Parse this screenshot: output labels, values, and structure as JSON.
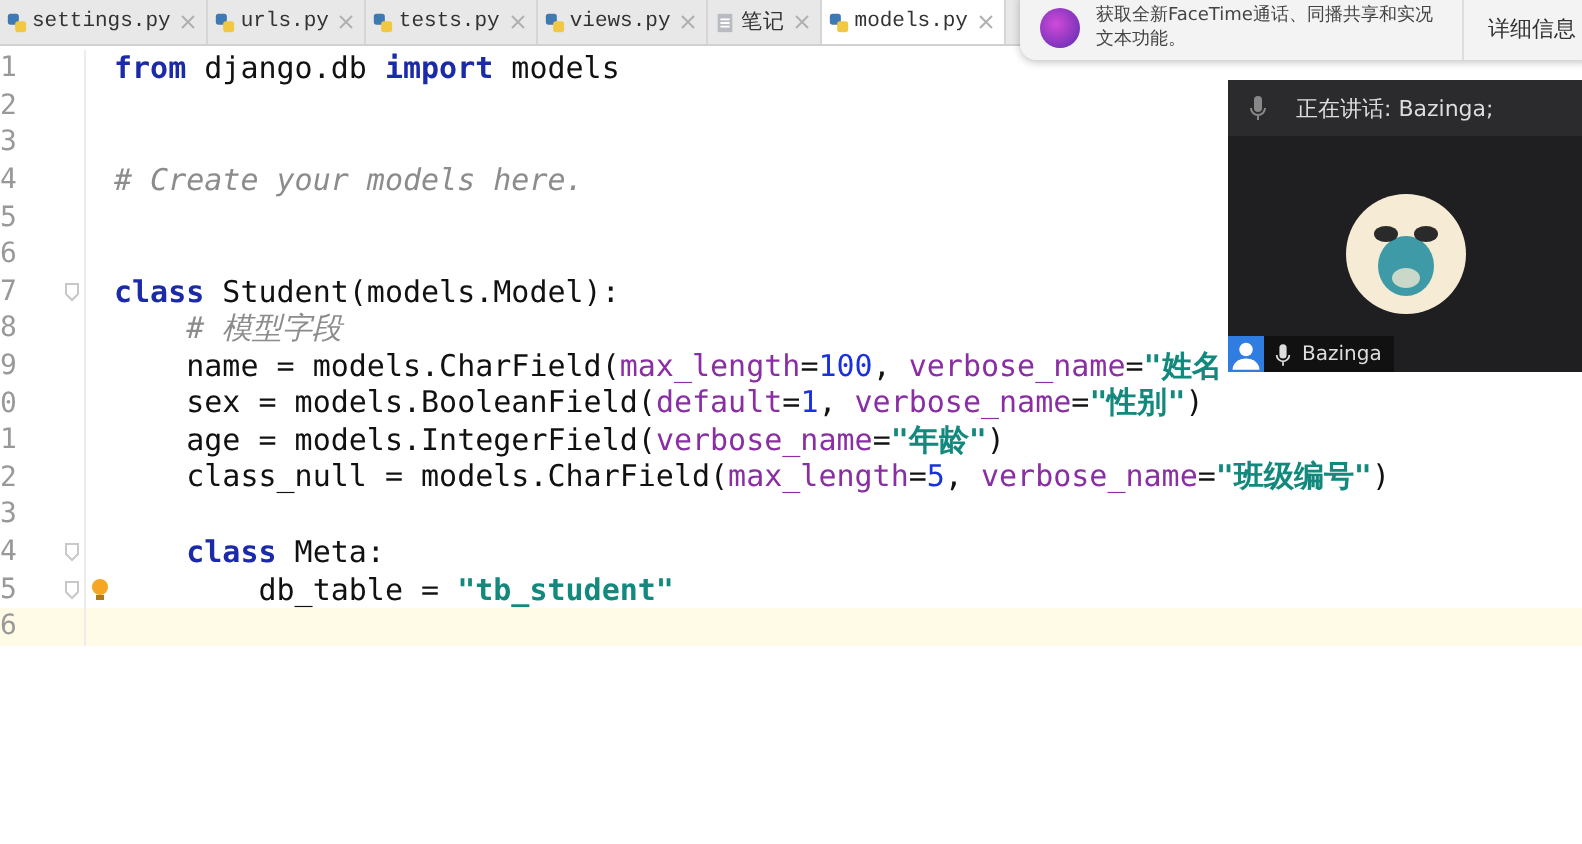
{
  "tabs": [
    {
      "label": "settings.py",
      "kind": "python",
      "selected": false
    },
    {
      "label": "urls.py",
      "kind": "python",
      "selected": false
    },
    {
      "label": "tests.py",
      "kind": "python",
      "selected": false
    },
    {
      "label": "views.py",
      "kind": "python",
      "selected": false
    },
    {
      "label": "笔记",
      "kind": "text",
      "selected": false
    },
    {
      "label": "models.py",
      "kind": "python",
      "selected": true
    }
  ],
  "editor": {
    "lines": [
      {
        "number": "1",
        "tokens": [
          {
            "kind": "keyword",
            "text": "from"
          },
          {
            "kind": "plain",
            "text": " django.db "
          },
          {
            "kind": "keyword",
            "text": "import"
          },
          {
            "kind": "plain",
            "text": " models"
          }
        ]
      },
      {
        "number": "2"
      },
      {
        "number": "3"
      },
      {
        "number": "4",
        "tokens": [
          {
            "kind": "comment",
            "text": "# Create your models here."
          }
        ]
      },
      {
        "number": "5"
      },
      {
        "number": "6"
      },
      {
        "number": "7",
        "fold": true,
        "tokens": [
          {
            "kind": "keyword",
            "text": "class"
          },
          {
            "kind": "plain",
            "text": " Student(models.Model):"
          }
        ]
      },
      {
        "number": "8",
        "tokens": [
          {
            "kind": "comment",
            "text": "    # 模型字段"
          }
        ]
      },
      {
        "number": "9",
        "tokens": [
          {
            "kind": "plain",
            "text": "    name = models.CharField("
          },
          {
            "kind": "param",
            "text": "max_length"
          },
          {
            "kind": "plain",
            "text": "="
          },
          {
            "kind": "number",
            "text": "100"
          },
          {
            "kind": "plain",
            "text": ", "
          },
          {
            "kind": "param",
            "text": "verbose_name"
          },
          {
            "kind": "plain",
            "text": "="
          },
          {
            "kind": "string",
            "text": "\"姓名"
          }
        ]
      },
      {
        "number": "0",
        "tokens": [
          {
            "kind": "plain",
            "text": "    sex = models.BooleanField("
          },
          {
            "kind": "param",
            "text": "default"
          },
          {
            "kind": "plain",
            "text": "="
          },
          {
            "kind": "number",
            "text": "1"
          },
          {
            "kind": "plain",
            "text": ", "
          },
          {
            "kind": "param",
            "text": "verbose_name"
          },
          {
            "kind": "plain",
            "text": "="
          },
          {
            "kind": "string",
            "text": "\"性别\""
          },
          {
            "kind": "plain",
            "text": ")"
          }
        ]
      },
      {
        "number": "1",
        "tokens": [
          {
            "kind": "plain",
            "text": "    age = models.IntegerField("
          },
          {
            "kind": "param",
            "text": "verbose_name"
          },
          {
            "kind": "plain",
            "text": "="
          },
          {
            "kind": "string",
            "text": "\"年龄\""
          },
          {
            "kind": "plain",
            "text": ")"
          }
        ]
      },
      {
        "number": "2",
        "tokens": [
          {
            "kind": "plain",
            "text": "    class_null = models.CharField("
          },
          {
            "kind": "param",
            "text": "max_length"
          },
          {
            "kind": "plain",
            "text": "="
          },
          {
            "kind": "number",
            "text": "5"
          },
          {
            "kind": "plain",
            "text": ", "
          },
          {
            "kind": "param",
            "text": "verbose_name"
          },
          {
            "kind": "plain",
            "text": "="
          },
          {
            "kind": "string",
            "text": "\"班级编号\""
          },
          {
            "kind": "plain",
            "text": ")"
          }
        ]
      },
      {
        "number": "3"
      },
      {
        "number": "4",
        "fold": true,
        "tokens": [
          {
            "kind": "keyword",
            "text": "    class"
          },
          {
            "kind": "plain",
            "text": " Meta:"
          }
        ]
      },
      {
        "number": "5",
        "fold": true,
        "bulb": true,
        "tokens": [
          {
            "kind": "plain",
            "text": "        db_table = "
          },
          {
            "kind": "string",
            "text": "\"tb_student\""
          }
        ]
      },
      {
        "number": "6",
        "current": true
      }
    ]
  },
  "notification": {
    "line_1": "获取全新FaceTime通话、同播共享和实况",
    "line_2": "文本功能。",
    "button": "详细信息"
  },
  "video_call": {
    "speaking": "正在讲话: Bazinga;",
    "participant": "Bazinga"
  }
}
